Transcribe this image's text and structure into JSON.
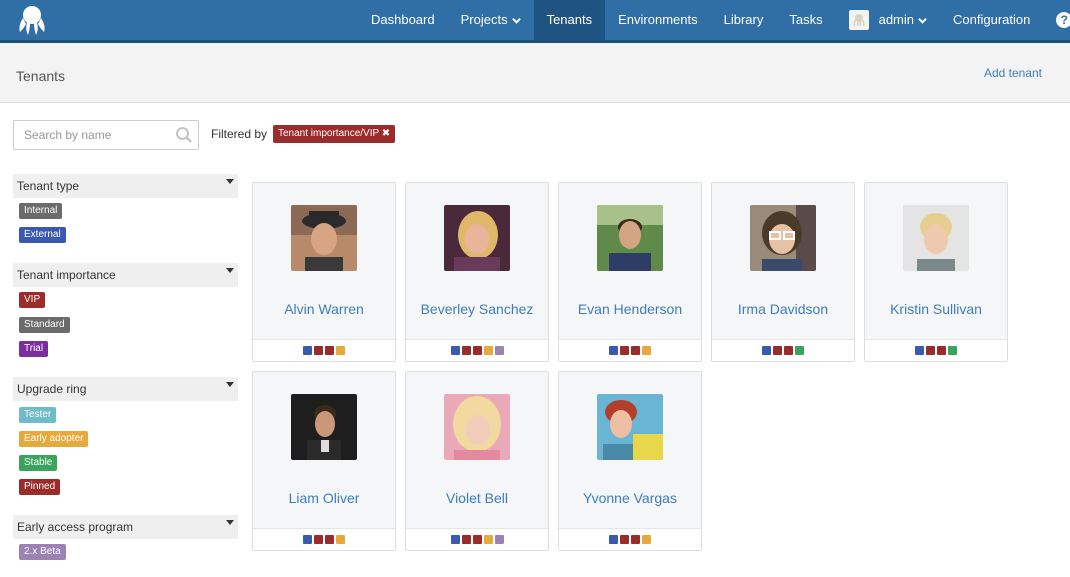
{
  "colors": {
    "nav_bg": "#2f6fa6",
    "nav_active": "#1f5482",
    "link": "#3e7dbd",
    "internal": "#6b6b6b",
    "external": "#3a5ab0",
    "vip": "#9b2c2c",
    "standard": "#6b6b6b",
    "trial": "#7a2d9b",
    "tester": "#6fbcc6",
    "early_adopter": "#e7a93b",
    "stable": "#3aa35c",
    "pinned": "#9b2c2c",
    "beta": "#9a82b3"
  },
  "nav": {
    "items": [
      {
        "label": "Dashboard"
      },
      {
        "label": "Projects"
      },
      {
        "label": "Tenants"
      },
      {
        "label": "Environments"
      },
      {
        "label": "Library"
      },
      {
        "label": "Tasks"
      },
      {
        "label": "admin"
      },
      {
        "label": "Configuration"
      }
    ],
    "help_label": "?"
  },
  "page": {
    "title": "Tenants",
    "add_label": "Add tenant"
  },
  "search": {
    "placeholder": "Search by name",
    "value": ""
  },
  "filter": {
    "label": "Filtered by",
    "chip": "Tenant importance/VIP ✖"
  },
  "sidebar": {
    "groups": [
      {
        "title": "Tenant type",
        "tags": [
          "Internal",
          "External"
        ]
      },
      {
        "title": "Tenant importance",
        "tags": [
          "VIP",
          "Standard",
          "Trial"
        ]
      },
      {
        "title": "Upgrade ring",
        "tags": [
          "Tester",
          "Early adopter",
          "Stable",
          "Pinned"
        ]
      },
      {
        "title": "Early access program",
        "tags": [
          "2.x Beta"
        ]
      }
    ]
  },
  "tenants": [
    {
      "name": "Alvin Warren",
      "tags": [
        "#3a5ab0",
        "#9b2c2c",
        "#9b2c2c",
        "#e7a93b"
      ]
    },
    {
      "name": "Beverley Sanchez",
      "tags": [
        "#3a5ab0",
        "#9b2c2c",
        "#9b2c2c",
        "#e7a93b",
        "#9a82b3"
      ]
    },
    {
      "name": "Evan Henderson",
      "tags": [
        "#3a5ab0",
        "#9b2c2c",
        "#9b2c2c",
        "#e7a93b"
      ]
    },
    {
      "name": "Irma Davidson",
      "tags": [
        "#3a5ab0",
        "#9b2c2c",
        "#9b2c2c",
        "#3aa35c"
      ]
    },
    {
      "name": "Kristin Sullivan",
      "tags": [
        "#3a5ab0",
        "#9b2c2c",
        "#9b2c2c",
        "#3aa35c"
      ]
    },
    {
      "name": "Liam Oliver",
      "tags": [
        "#3a5ab0",
        "#9b2c2c",
        "#9b2c2c",
        "#e7a93b"
      ]
    },
    {
      "name": "Violet Bell",
      "tags": [
        "#3a5ab0",
        "#9b2c2c",
        "#9b2c2c",
        "#e7a93b",
        "#9a82b3"
      ]
    },
    {
      "name": "Yvonne Vargas",
      "tags": [
        "#3a5ab0",
        "#9b2c2c",
        "#9b2c2c",
        "#e7a93b"
      ]
    }
  ]
}
